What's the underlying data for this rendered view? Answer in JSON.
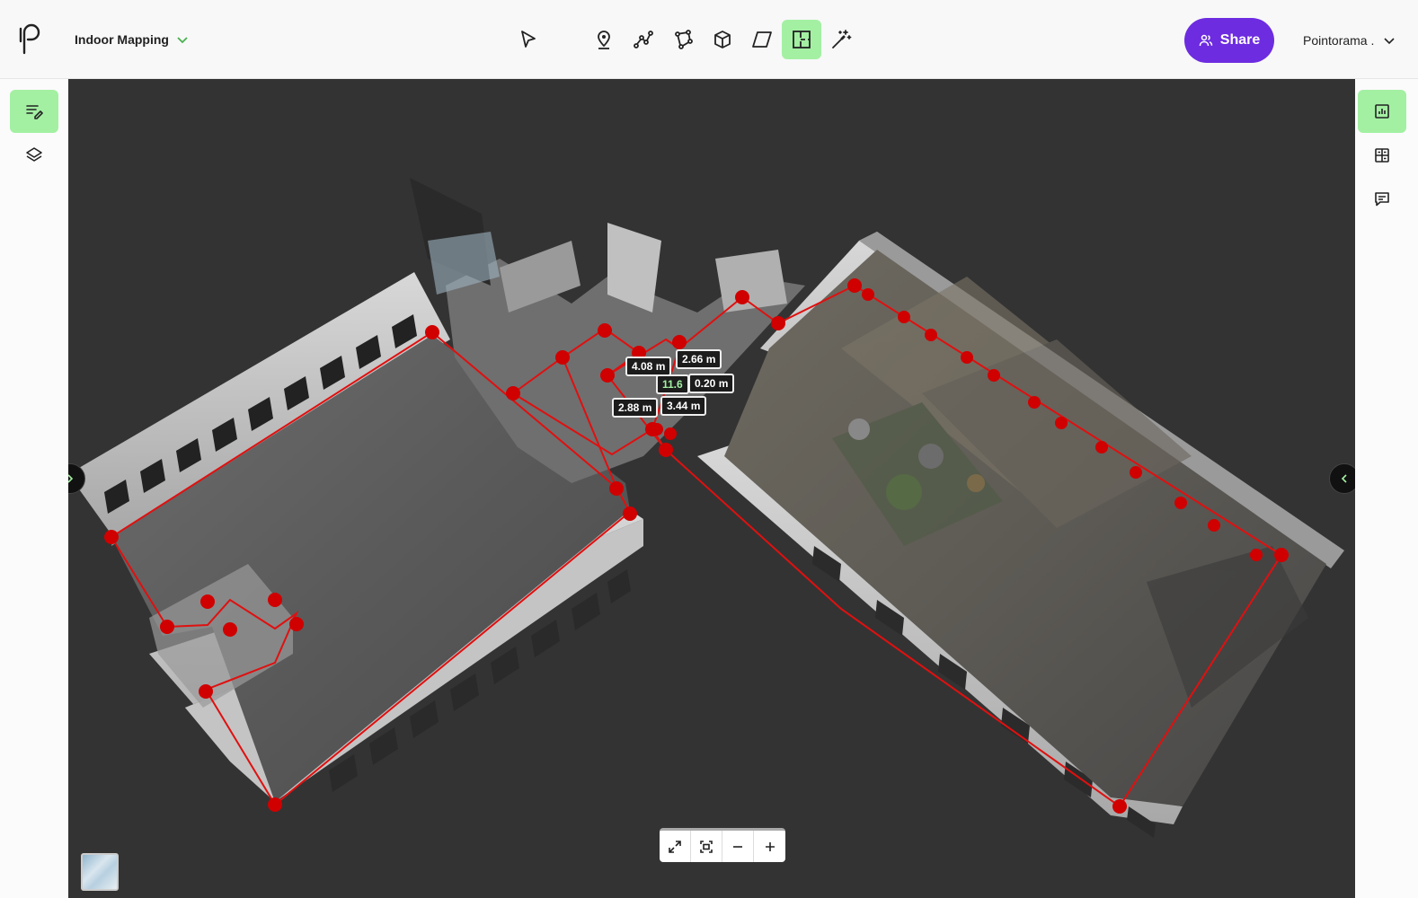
{
  "header": {
    "project_name": "Indoor Mapping",
    "share_label": "Share",
    "user_name": "Pointorama ."
  },
  "toolbar": {
    "tools": [
      {
        "name": "select",
        "icon": "cursor-icon",
        "active": false
      },
      {
        "name": "point",
        "icon": "location-pin-icon",
        "active": false
      },
      {
        "name": "polyline",
        "icon": "polyline-icon",
        "active": false
      },
      {
        "name": "polygon",
        "icon": "polygon-icon",
        "active": false
      },
      {
        "name": "box",
        "icon": "cube-icon",
        "active": false
      },
      {
        "name": "plane",
        "icon": "plane-icon",
        "active": false
      },
      {
        "name": "floor-plan",
        "icon": "floor-plan-icon",
        "active": true
      },
      {
        "name": "auto",
        "icon": "magic-wand-icon",
        "active": false
      }
    ]
  },
  "measurements": {
    "m1": "4.08 m",
    "m2": "2.66 m",
    "m3": "11.6",
    "m4": "0.20 m",
    "m5": "2.88 m",
    "m6": "3.44 m"
  },
  "colors": {
    "accent": "#a3f0a3",
    "share": "#6d2ce0",
    "outline": "#e01010",
    "viewport": "#333333"
  }
}
